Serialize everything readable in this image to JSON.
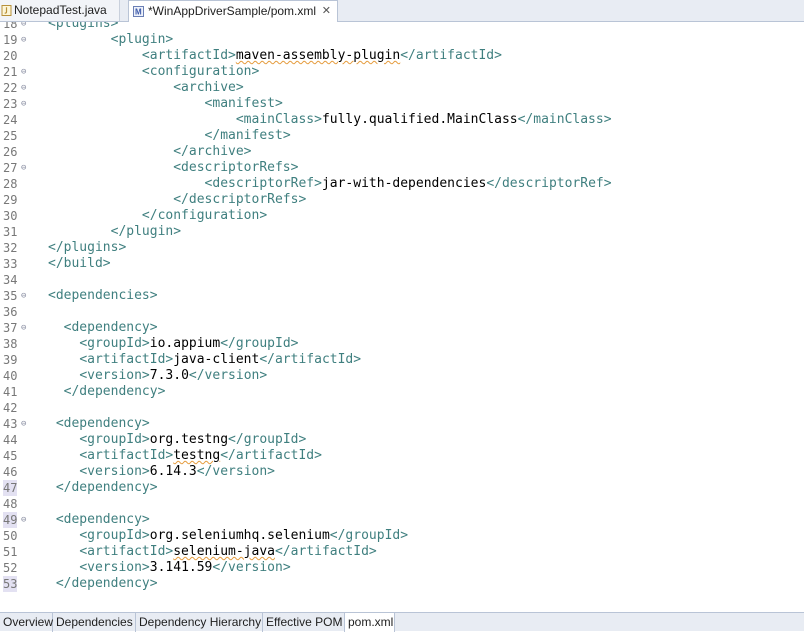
{
  "tabs": [
    {
      "label": "NotepadTest.java",
      "active": false,
      "icon": "java-file-icon"
    },
    {
      "label": "*WinAppDriverSample/pom.xml",
      "active": true,
      "icon": "maven-pom-icon",
      "close": "✕"
    }
  ],
  "lines": [
    {
      "n": "18",
      "fold": "⊖",
      "mark": false,
      "code": [
        [
          "tg",
          "<plugins>"
        ]
      ]
    },
    {
      "n": "19",
      "fold": "⊖",
      "mark": false,
      "code": [
        [
          "tx",
          "        "
        ],
        [
          "tg",
          "<plugin>"
        ]
      ]
    },
    {
      "n": "20",
      "fold": "",
      "mark": false,
      "code": [
        [
          "tx",
          "            "
        ],
        [
          "tg",
          "<artifactId>"
        ],
        [
          "sq",
          "maven-assembly-plugin"
        ],
        [
          "tg",
          "</artifactId>"
        ]
      ]
    },
    {
      "n": "21",
      "fold": "⊖",
      "mark": false,
      "code": [
        [
          "tx",
          "            "
        ],
        [
          "tg",
          "<configuration>"
        ]
      ]
    },
    {
      "n": "22",
      "fold": "⊖",
      "mark": false,
      "code": [
        [
          "tx",
          "                "
        ],
        [
          "tg",
          "<archive>"
        ]
      ]
    },
    {
      "n": "23",
      "fold": "⊖",
      "mark": false,
      "code": [
        [
          "tx",
          "                    "
        ],
        [
          "tg",
          "<manifest>"
        ]
      ]
    },
    {
      "n": "24",
      "fold": "",
      "mark": false,
      "code": [
        [
          "tx",
          "                        "
        ],
        [
          "tg",
          "<mainClass>"
        ],
        [
          "tx",
          "fully.qualified.MainClass"
        ],
        [
          "tg",
          "</mainClass>"
        ]
      ]
    },
    {
      "n": "25",
      "fold": "",
      "mark": false,
      "code": [
        [
          "tx",
          "                    "
        ],
        [
          "tg",
          "</manifest>"
        ]
      ]
    },
    {
      "n": "26",
      "fold": "",
      "mark": false,
      "code": [
        [
          "tx",
          "                "
        ],
        [
          "tg",
          "</archive>"
        ]
      ]
    },
    {
      "n": "27",
      "fold": "⊖",
      "mark": false,
      "code": [
        [
          "tx",
          "                "
        ],
        [
          "tg",
          "<descriptorRefs>"
        ]
      ]
    },
    {
      "n": "28",
      "fold": "",
      "mark": false,
      "code": [
        [
          "tx",
          "                    "
        ],
        [
          "tg",
          "<descriptorRef>"
        ],
        [
          "tx",
          "jar-with-dependencies"
        ],
        [
          "tg",
          "</descriptorRef>"
        ]
      ]
    },
    {
      "n": "29",
      "fold": "",
      "mark": false,
      "code": [
        [
          "tx",
          "                "
        ],
        [
          "tg",
          "</descriptorRefs>"
        ]
      ]
    },
    {
      "n": "30",
      "fold": "",
      "mark": false,
      "code": [
        [
          "tx",
          "            "
        ],
        [
          "tg",
          "</configuration>"
        ]
      ]
    },
    {
      "n": "31",
      "fold": "",
      "mark": false,
      "code": [
        [
          "tx",
          "        "
        ],
        [
          "tg",
          "</plugin>"
        ]
      ]
    },
    {
      "n": "32",
      "fold": "",
      "mark": false,
      "code": [
        [
          "tg",
          "</plugins>"
        ]
      ]
    },
    {
      "n": "33",
      "fold": "",
      "mark": false,
      "code": [
        [
          "tg",
          "</build>"
        ]
      ]
    },
    {
      "n": "34",
      "fold": "",
      "mark": false,
      "code": []
    },
    {
      "n": "35",
      "fold": "⊖",
      "mark": false,
      "code": [
        [
          "tg",
          "<dependencies>"
        ]
      ]
    },
    {
      "n": "36",
      "fold": "",
      "mark": false,
      "code": []
    },
    {
      "n": "37",
      "fold": "⊖",
      "mark": false,
      "code": [
        [
          "tx",
          "  "
        ],
        [
          "tg",
          "<dependency>"
        ]
      ]
    },
    {
      "n": "38",
      "fold": "",
      "mark": false,
      "code": [
        [
          "tx",
          "    "
        ],
        [
          "tg",
          "<groupId>"
        ],
        [
          "tx",
          "io.appium"
        ],
        [
          "tg",
          "</groupId>"
        ]
      ]
    },
    {
      "n": "39",
      "fold": "",
      "mark": false,
      "code": [
        [
          "tx",
          "    "
        ],
        [
          "tg",
          "<artifactId>"
        ],
        [
          "tx",
          "java-client"
        ],
        [
          "tg",
          "</artifactId>"
        ]
      ]
    },
    {
      "n": "40",
      "fold": "",
      "mark": false,
      "code": [
        [
          "tx",
          "    "
        ],
        [
          "tg",
          "<version>"
        ],
        [
          "tx",
          "7.3.0"
        ],
        [
          "tg",
          "</version>"
        ]
      ]
    },
    {
      "n": "41",
      "fold": "",
      "mark": false,
      "code": [
        [
          "tx",
          "  "
        ],
        [
          "tg",
          "</dependency>"
        ]
      ]
    },
    {
      "n": "42",
      "fold": "",
      "mark": false,
      "code": []
    },
    {
      "n": "43",
      "fold": "⊖",
      "mark": false,
      "code": [
        [
          "tx",
          " "
        ],
        [
          "tg",
          "<dependency>"
        ]
      ]
    },
    {
      "n": "44",
      "fold": "",
      "mark": false,
      "code": [
        [
          "tx",
          "    "
        ],
        [
          "tg",
          "<groupId>"
        ],
        [
          "tx",
          "org.testng"
        ],
        [
          "tg",
          "</groupId>"
        ]
      ]
    },
    {
      "n": "45",
      "fold": "",
      "mark": false,
      "code": [
        [
          "tx",
          "    "
        ],
        [
          "tg",
          "<artifactId>"
        ],
        [
          "sq",
          "testng"
        ],
        [
          "tg",
          "</artifactId>"
        ]
      ]
    },
    {
      "n": "46",
      "fold": "",
      "mark": false,
      "code": [
        [
          "tx",
          "    "
        ],
        [
          "tg",
          "<version>"
        ],
        [
          "tx",
          "6.14.3"
        ],
        [
          "tg",
          "</version>"
        ]
      ]
    },
    {
      "n": "47",
      "fold": "",
      "mark": true,
      "code": [
        [
          "tx",
          " "
        ],
        [
          "tg",
          "</dependency>"
        ]
      ]
    },
    {
      "n": "48",
      "fold": "",
      "mark": false,
      "code": []
    },
    {
      "n": "49",
      "fold": "⊖",
      "mark": true,
      "code": [
        [
          "tx",
          " "
        ],
        [
          "tg",
          "<dependency>"
        ]
      ]
    },
    {
      "n": "50",
      "fold": "",
      "mark": false,
      "code": [
        [
          "tx",
          "    "
        ],
        [
          "tg",
          "<groupId>"
        ],
        [
          "tx",
          "org.seleniumhq.selenium"
        ],
        [
          "tg",
          "</groupId>"
        ]
      ]
    },
    {
      "n": "51",
      "fold": "",
      "mark": false,
      "code": [
        [
          "tx",
          "    "
        ],
        [
          "tg",
          "<artifactId>"
        ],
        [
          "sq",
          "selenium-java"
        ],
        [
          "tg",
          "</artifactId>"
        ]
      ]
    },
    {
      "n": "52",
      "fold": "",
      "mark": false,
      "code": [
        [
          "tx",
          "    "
        ],
        [
          "tg",
          "<version>"
        ],
        [
          "tx",
          "3.141.59"
        ],
        [
          "tg",
          "</version>"
        ]
      ]
    },
    {
      "n": "53",
      "fold": "",
      "mark": true,
      "code": [
        [
          "tx",
          " "
        ],
        [
          "tg",
          "</dependency>"
        ]
      ]
    }
  ],
  "hscroll_arrow": "‹",
  "bottom_tabs": [
    {
      "label": "Overview",
      "active": false
    },
    {
      "label": "Dependencies",
      "active": false
    },
    {
      "label": "Dependency Hierarchy",
      "active": false
    },
    {
      "label": "Effective POM",
      "active": false
    },
    {
      "label": "pom.xml",
      "active": true
    }
  ],
  "colors": {
    "tag": "#3f7f7f",
    "text": "#000000",
    "line_number": "#787878",
    "squiggle": "#e59b3c"
  }
}
